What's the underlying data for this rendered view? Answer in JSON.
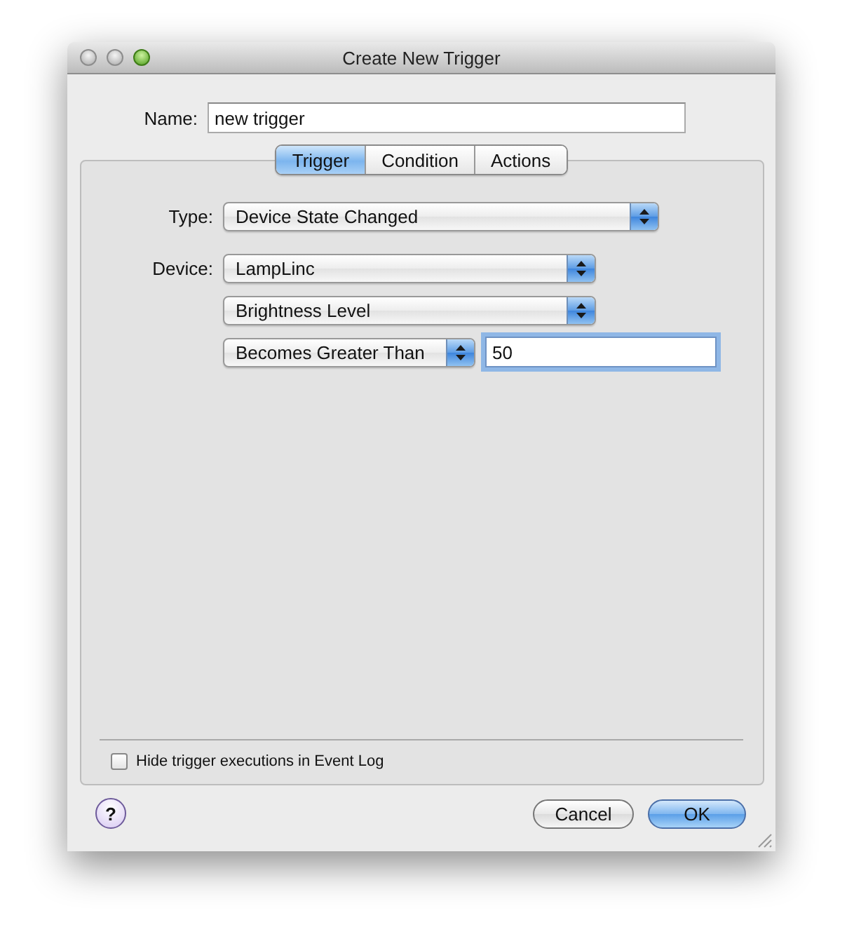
{
  "window": {
    "title": "Create New Trigger"
  },
  "name": {
    "label": "Name:",
    "value": "new trigger"
  },
  "tabs": [
    {
      "label": "Trigger",
      "selected": true
    },
    {
      "label": "Condition",
      "selected": false
    },
    {
      "label": "Actions",
      "selected": false
    }
  ],
  "type": {
    "label": "Type:",
    "value": "Device State Changed"
  },
  "device": {
    "label": "Device:",
    "value": "LampLinc"
  },
  "property": {
    "value": "Brightness Level"
  },
  "comparison": {
    "value": "Becomes Greater Than"
  },
  "threshold": {
    "value": "50",
    "focused": true
  },
  "hide_executions": {
    "label": "Hide trigger executions in Event Log",
    "checked": false
  },
  "help": {
    "label": "?"
  },
  "buttons": [
    {
      "label": "Cancel",
      "default": false
    },
    {
      "label": "OK",
      "default": true
    }
  ]
}
